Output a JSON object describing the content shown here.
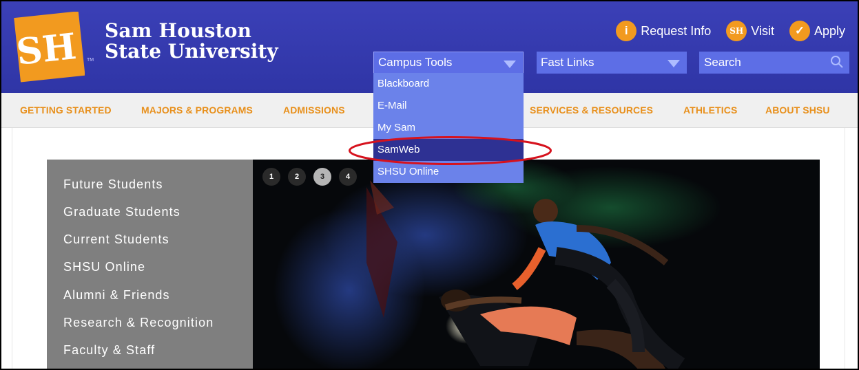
{
  "brand": {
    "logo_letters": "SH",
    "logo_tm": "TM",
    "name_line1": "Sam Houston",
    "name_line2": "State University",
    "colors": {
      "header_blue": "#3b40b7",
      "orange": "#f29a1f",
      "nav_text": "#e8901c"
    }
  },
  "top_links": [
    {
      "label": "Request Info",
      "icon": "info-icon",
      "glyph": "i"
    },
    {
      "label": "Visit",
      "icon": "sh-seal-icon",
      "glyph": "SH"
    },
    {
      "label": "Apply",
      "icon": "checkmark-icon",
      "glyph": "✓"
    }
  ],
  "campus_tools": {
    "label": "Campus Tools",
    "items": [
      "Blackboard",
      "E-Mail",
      "My Sam",
      "SamWeb",
      "SHSU Online"
    ],
    "highlighted": "SamWeb"
  },
  "fast_links": {
    "label": "Fast Links"
  },
  "search": {
    "placeholder": "Search"
  },
  "main_nav": [
    "GETTING STARTED",
    "MAJORS & PROGRAMS",
    "ADMISSIONS",
    "SERVICES & RESOURCES",
    "ATHLETICS",
    "ABOUT SHSU"
  ],
  "side_nav": [
    "Future Students",
    "Graduate Students",
    "Current Students",
    "SHSU Online",
    "Alumni & Friends",
    "Research & Recognition",
    "Faculty & Staff"
  ],
  "slider": {
    "pages": [
      "1",
      "2",
      "3",
      "4"
    ],
    "current": "3"
  }
}
